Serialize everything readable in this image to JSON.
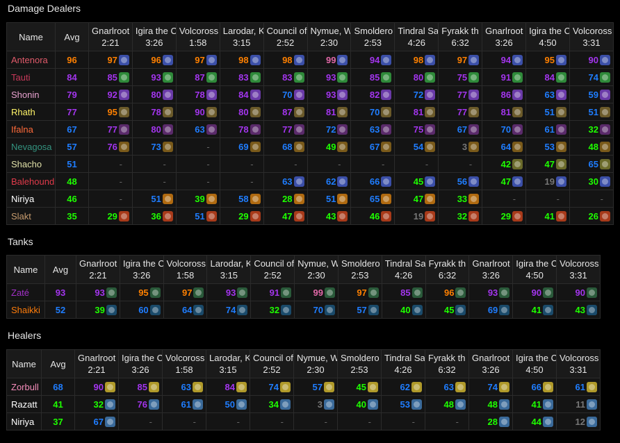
{
  "columns": [
    {
      "name": "Gnarlroot",
      "time": "2:21"
    },
    {
      "name": "Igira the C",
      "time": "3:26"
    },
    {
      "name": "Volcoross",
      "time": "1:58"
    },
    {
      "name": "Larodar, K",
      "time": "3:15"
    },
    {
      "name": "Council of",
      "time": "2:52"
    },
    {
      "name": "Nymue, W",
      "time": "2:30"
    },
    {
      "name": "Smoldero",
      "time": "2:53"
    },
    {
      "name": "Tindral Sa",
      "time": "4:26"
    },
    {
      "name": "Fyrakk th",
      "time": "6:32"
    },
    {
      "name": "Gnarlroot",
      "time": "3:26"
    },
    {
      "name": "Igira the C",
      "time": "4:50"
    },
    {
      "name": "Volcoross",
      "time": "3:31"
    }
  ],
  "headers": {
    "name": "Name",
    "avg": "Avg"
  },
  "colors": {
    "orange": "#ff8000",
    "purple": "#a335ee",
    "blue": "#1f7dff",
    "green": "#1eff00",
    "grey": "#777777",
    "pink": "#e268a8"
  },
  "sections": [
    {
      "title": "Damage Dealers",
      "rows": [
        {
          "name": "Antenora",
          "name_color": "#e05a6a",
          "avg": "96",
          "icon": "frost-mage-icon",
          "icon_color": "#3b4fa8",
          "cells": [
            "97",
            "96",
            "97",
            "98",
            "98",
            "99",
            "94",
            "98",
            "97",
            "94",
            "95",
            "90"
          ],
          "q": [
            "orange",
            "orange",
            "orange",
            "orange",
            "orange",
            "pink",
            "purple",
            "orange",
            "orange",
            "purple",
            "orange",
            "purple"
          ]
        },
        {
          "name": "Tauti",
          "name_color": "#c9395a",
          "avg": "84",
          "icon": "affliction-icon",
          "icon_color": "#2f8a3a",
          "cells": [
            "85",
            "93",
            "87",
            "83",
            "83",
            "93",
            "85",
            "80",
            "75",
            "91",
            "84",
            "74"
          ],
          "q": [
            "purple",
            "purple",
            "purple",
            "purple",
            "purple",
            "purple",
            "purple",
            "purple",
            "purple",
            "purple",
            "purple",
            "blue"
          ]
        },
        {
          "name": "Shonin",
          "name_color": "#e9a2d0",
          "avg": "79",
          "icon": "shadow-icon",
          "icon_color": "#6a3aa8",
          "cells": [
            "92",
            "80",
            "78",
            "84",
            "70",
            "93",
            "82",
            "72",
            "77",
            "86",
            "63",
            "59"
          ],
          "q": [
            "purple",
            "purple",
            "purple",
            "purple",
            "blue",
            "purple",
            "purple",
            "blue",
            "purple",
            "purple",
            "blue",
            "blue"
          ]
        },
        {
          "name": "Rhath",
          "name_color": "#fff468",
          "avg": "77",
          "icon": "rogue-icon",
          "icon_color": "#6b5a2a",
          "cells": [
            "95",
            "78",
            "90",
            "80",
            "87",
            "81",
            "70",
            "81",
            "77",
            "81",
            "51",
            "51"
          ],
          "q": [
            "orange",
            "purple",
            "purple",
            "purple",
            "purple",
            "purple",
            "blue",
            "purple",
            "purple",
            "purple",
            "blue",
            "blue"
          ]
        },
        {
          "name": "Ifalna",
          "name_color": "#ff6b3a",
          "avg": "67",
          "icon": "retribution-icon",
          "icon_color": "#5a2a6a",
          "cells": [
            "77",
            "80",
            "63",
            "78",
            "77",
            "72",
            "63",
            "75",
            "67",
            "70",
            "61",
            "32"
          ],
          "q": [
            "purple",
            "purple",
            "blue",
            "purple",
            "purple",
            "blue",
            "blue",
            "purple",
            "blue",
            "blue",
            "blue",
            "green"
          ]
        },
        {
          "name": "Nevagosa",
          "name_color": "#33937f",
          "avg": "57",
          "icon": "evoker-icon",
          "icon_color": "#7a5a1a",
          "cells": [
            "76",
            "73",
            "-",
            "69",
            "68",
            "49",
            "67",
            "54",
            "3",
            "64",
            "53",
            "48"
          ],
          "q": [
            "purple",
            "blue",
            "grey",
            "blue",
            "blue",
            "green",
            "blue",
            "blue",
            "grey",
            "blue",
            "blue",
            "green"
          ]
        },
        {
          "name": "Shacho",
          "name_color": "#e0e0a8",
          "avg": "51",
          "icon": "hunter-icon",
          "icon_color": "#6a6a2a",
          "cells": [
            "-",
            "-",
            "-",
            "-",
            "-",
            "-",
            "-",
            "-",
            "-",
            "42",
            "47",
            "65"
          ],
          "q": [
            "grey",
            "grey",
            "grey",
            "grey",
            "grey",
            "grey",
            "grey",
            "grey",
            "grey",
            "green",
            "green",
            "blue"
          ]
        },
        {
          "name": "Balehound",
          "name_color": "#e03a4a",
          "avg": "48",
          "icon": "frost-dk-icon",
          "icon_color": "#3b4fa8",
          "cells": [
            "-",
            "-",
            "-",
            "-",
            "63",
            "62",
            "66",
            "45",
            "56",
            "47",
            "19",
            "30"
          ],
          "q": [
            "grey",
            "grey",
            "grey",
            "grey",
            "blue",
            "blue",
            "blue",
            "green",
            "blue",
            "green",
            "grey",
            "green"
          ]
        },
        {
          "name": "Niriya",
          "name_color": "#ffffff",
          "avg": "46",
          "icon": "fire-icon",
          "icon_color": "#b06a10",
          "cells": [
            "-",
            "51",
            "39",
            "58",
            "28",
            "51",
            "65",
            "47",
            "33",
            "-",
            "-",
            "-"
          ],
          "q": [
            "grey",
            "blue",
            "green",
            "blue",
            "green",
            "blue",
            "blue",
            "green",
            "green",
            "grey",
            "grey",
            "grey"
          ]
        },
        {
          "name": "Slakt",
          "name_color": "#c79c6e",
          "avg": "35",
          "icon": "warrior-icon",
          "icon_color": "#a83a1a",
          "cells": [
            "29",
            "36",
            "51",
            "29",
            "47",
            "43",
            "46",
            "19",
            "32",
            "29",
            "41",
            "26"
          ],
          "q": [
            "green",
            "green",
            "blue",
            "green",
            "green",
            "green",
            "green",
            "grey",
            "green",
            "green",
            "green",
            "green"
          ]
        }
      ]
    },
    {
      "title": "Tanks",
      "rows": [
        {
          "name": "Zaté",
          "name_color": "#a330c9",
          "avg": "93",
          "icon": "vengeance-icon",
          "icon_color": "#2a5a3a",
          "cells": [
            "93",
            "95",
            "97",
            "93",
            "91",
            "99",
            "97",
            "85",
            "96",
            "93",
            "90",
            "90"
          ],
          "q": [
            "purple",
            "orange",
            "orange",
            "purple",
            "purple",
            "pink",
            "orange",
            "purple",
            "orange",
            "purple",
            "purple",
            "purple"
          ]
        },
        {
          "name": "Shaikki",
          "name_color": "#ff7c0a",
          "avg": "52",
          "icon": "guardian-icon",
          "icon_color": "#1a4a6a",
          "cells": [
            "39",
            "60",
            "64",
            "74",
            "32",
            "70",
            "57",
            "40",
            "45",
            "69",
            "41",
            "43"
          ],
          "q": [
            "green",
            "blue",
            "blue",
            "blue",
            "green",
            "blue",
            "blue",
            "green",
            "green",
            "blue",
            "green",
            "green"
          ]
        }
      ]
    },
    {
      "title": "Healers",
      "rows": [
        {
          "name": "Zorbull",
          "name_color": "#f48cba",
          "avg": "68",
          "icon": "holy-paladin-icon",
          "icon_color": "#b09a2a",
          "cells": [
            "90",
            "85",
            "63",
            "84",
            "74",
            "57",
            "45",
            "62",
            "63",
            "74",
            "66",
            "61"
          ],
          "q": [
            "purple",
            "purple",
            "blue",
            "purple",
            "blue",
            "blue",
            "green",
            "blue",
            "blue",
            "blue",
            "blue",
            "blue"
          ]
        },
        {
          "name": "Razatt",
          "name_color": "#ffffff",
          "avg": "41",
          "icon": "discipline-icon",
          "icon_color": "#3a6a9a",
          "cells": [
            "32",
            "76",
            "61",
            "50",
            "34",
            "3",
            "40",
            "53",
            "48",
            "48",
            "41",
            "11"
          ],
          "q": [
            "green",
            "purple",
            "blue",
            "blue",
            "green",
            "grey",
            "green",
            "blue",
            "green",
            "green",
            "green",
            "grey"
          ]
        },
        {
          "name": "Niriya",
          "name_color": "#ffffff",
          "avg": "37",
          "icon": "discipline-icon",
          "icon_color": "#3a6a9a",
          "cells": [
            "67",
            "-",
            "-",
            "-",
            "-",
            "-",
            "-",
            "-",
            "-",
            "28",
            "44",
            "12"
          ],
          "q": [
            "blue",
            "grey",
            "grey",
            "grey",
            "grey",
            "grey",
            "grey",
            "grey",
            "grey",
            "green",
            "green",
            "grey"
          ]
        }
      ]
    }
  ]
}
